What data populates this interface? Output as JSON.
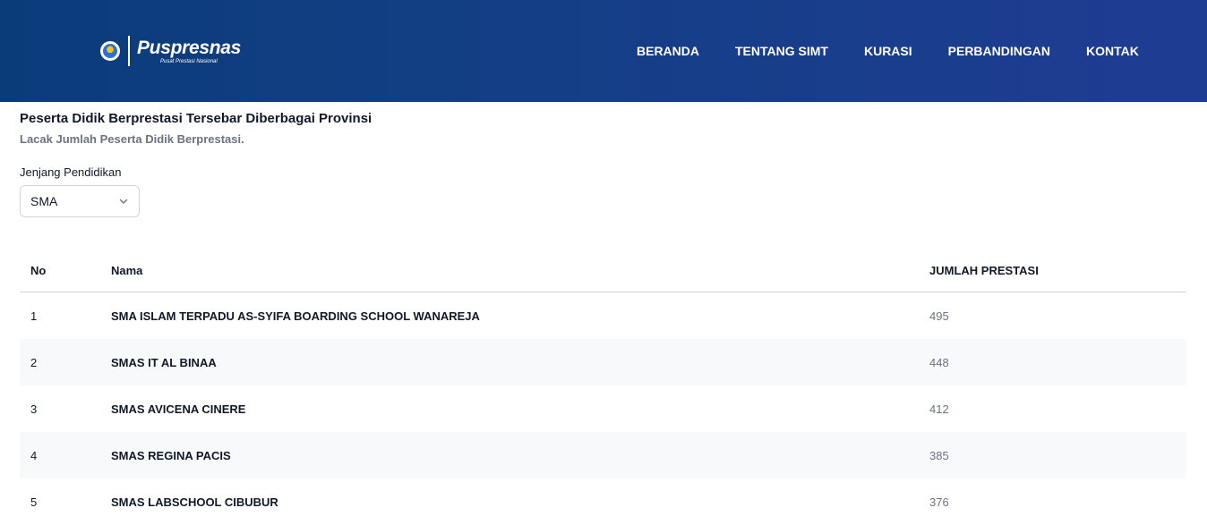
{
  "header": {
    "brand": "Puspresnas",
    "brand_sub": "Pusat Prestasi Nasional",
    "nav": [
      {
        "label": "BERANDA"
      },
      {
        "label": "TENTANG SIMT"
      },
      {
        "label": "KURASI"
      },
      {
        "label": "PERBANDINGAN"
      },
      {
        "label": "KONTAK"
      }
    ]
  },
  "main": {
    "title": "Peserta Didik Berprestasi Tersebar Diberbagai Provinsi",
    "subtitle": "Lacak Jumlah Peserta Didik Berprestasi.",
    "filter": {
      "label": "Jenjang Pendidikan",
      "value": "SMA"
    },
    "table": {
      "columns": [
        "No",
        "Nama",
        "JUMLAH PRESTASI"
      ],
      "rows": [
        {
          "no": "1",
          "name": "SMA ISLAM TERPADU AS-SYIFA BOARDING SCHOOL WANAREJA",
          "count": "495"
        },
        {
          "no": "2",
          "name": "SMAS IT AL BINAA",
          "count": "448"
        },
        {
          "no": "3",
          "name": "SMAS AVICENA CINERE",
          "count": "412"
        },
        {
          "no": "4",
          "name": "SMAS REGINA PACIS",
          "count": "385"
        },
        {
          "no": "5",
          "name": "SMAS LABSCHOOL CIBUBUR",
          "count": "376"
        }
      ]
    }
  },
  "colors": {
    "header_start": "#0b3c7a",
    "header_end": "#1f3c93",
    "row_alt": "#f8f9fa",
    "muted_text": "#6b7280"
  },
  "icons": {
    "emblem": "tut-wuri-handayani-emblem",
    "select": "chevron-down-icon"
  }
}
